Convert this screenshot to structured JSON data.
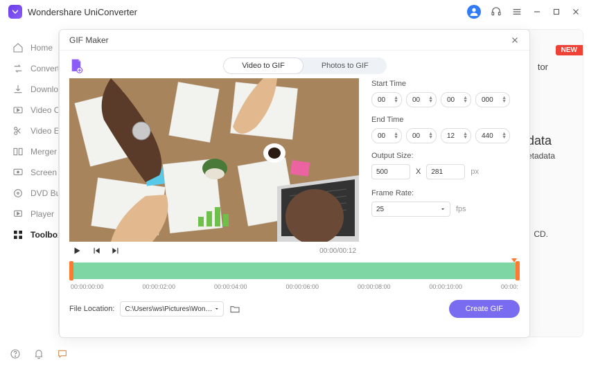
{
  "app": {
    "title": "Wondershare UniConverter"
  },
  "sidebar": {
    "items": [
      {
        "label": "Home"
      },
      {
        "label": "Converter"
      },
      {
        "label": "Downloader"
      },
      {
        "label": "Video Compressor"
      },
      {
        "label": "Video Editor"
      },
      {
        "label": "Merger"
      },
      {
        "label": "Screen Recorder"
      },
      {
        "label": "DVD Burner"
      },
      {
        "label": "Player"
      },
      {
        "label": "Toolbox"
      }
    ]
  },
  "bg": {
    "new_badge": "NEW",
    "tor": "tor",
    "data_head": "data",
    "data_sub": "etadata",
    "cd": "CD."
  },
  "modal": {
    "title": "GIF Maker",
    "tabs": {
      "video": "Video to GIF",
      "photos": "Photos to GIF"
    },
    "start_label": "Start Time",
    "end_label": "End Time",
    "start": {
      "h": "00",
      "m": "00",
      "s": "00",
      "ms": "000"
    },
    "end": {
      "h": "00",
      "m": "00",
      "s": "12",
      "ms": "440"
    },
    "output_size_label": "Output Size:",
    "output": {
      "w": "500",
      "x": "X",
      "h": "281",
      "unit": "px"
    },
    "frame_rate_label": "Frame Rate:",
    "frame_rate": "25",
    "fps": "fps",
    "playtime": "00:00/00:12",
    "ruler": [
      "00:00:00:00",
      "00:00:02:00",
      "00:00:04:00",
      "00:00:06:00",
      "00:00:08:00",
      "00:00:10:00",
      "00:00:"
    ],
    "file_location_label": "File Location:",
    "file_location": "C:\\Users\\ws\\Pictures\\Wonders",
    "create_label": "Create GIF"
  }
}
